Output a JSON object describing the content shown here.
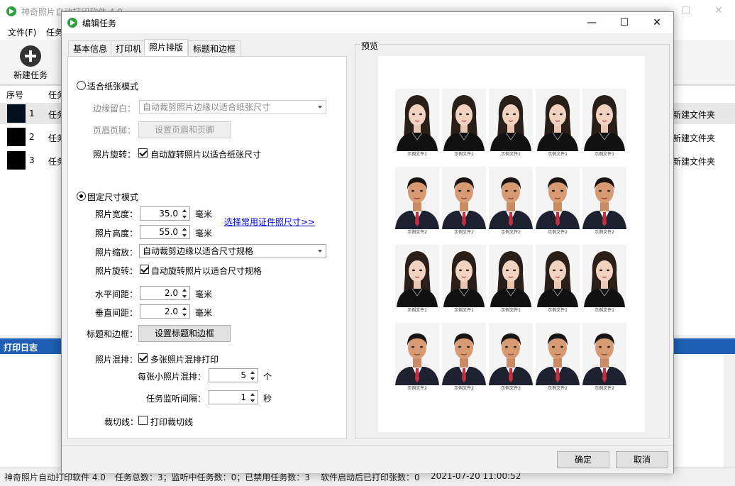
{
  "main": {
    "title": "神奇照片自动打印软件 4.0",
    "menu": [
      "文件(F)",
      "任务"
    ],
    "toolbar": {
      "new_task": "新建任务"
    },
    "list_headers": {
      "index": "序号",
      "task": "任务"
    },
    "tasks": [
      {
        "index": "1",
        "name": "任务",
        "folder": "新建文件夹"
      },
      {
        "index": "2",
        "name": "任务",
        "folder": "新建文件夹"
      },
      {
        "index": "3",
        "name": "任务",
        "folder": "新建文件夹"
      }
    ],
    "log_title": "打印日志",
    "status": {
      "app": "神奇照片自动打印软件 4.0",
      "counts": "任务总数：3；监听中任务数：0；已禁用任务数：3",
      "printed": "软件启动后已打印张数：0",
      "time": "2021-07-20 11:00:52"
    }
  },
  "dialog": {
    "title": "编辑任务",
    "tabs": [
      "基本信息",
      "打印机",
      "照片排版",
      "标题和边框"
    ],
    "active_tab": "照片排版",
    "fit_mode": {
      "label": "适合纸张模式",
      "selected": false,
      "margin_label": "边缘留白：",
      "margin_value": "自动裁剪照片边缘以适合纸张尺寸",
      "header_label": "页眉页脚：",
      "header_button": "设置页眉和页脚",
      "rotate_label": "照片旋转：",
      "rotate_text": "自动旋转照片以适合纸张尺寸",
      "rotate_checked": true
    },
    "fixed_mode": {
      "label": "固定尺寸模式",
      "selected": true,
      "width_label": "照片宽度：",
      "width_value": "35.0",
      "height_label": "照片高度：",
      "height_value": "55.0",
      "unit_mm": "毫米",
      "preset_link": "选择常用证件照尺寸>>",
      "scale_label": "照片缩放：",
      "scale_value": "自动裁剪边缘以适合尺寸规格",
      "rotate_label": "照片旋转：",
      "rotate_text": "自动旋转照片以适合尺寸规格",
      "rotate_checked": true,
      "hgap_label": "水平间距：",
      "hgap_value": "2.0",
      "vgap_label": "垂直间距：",
      "vgap_value": "2.0",
      "title_border_label": "标题和边框：",
      "title_border_button": "设置标题和边框",
      "mix_label": "照片混排：",
      "mix_text": "多张照片混排打印",
      "mix_checked": true,
      "per_sheet_label": "每张小照片混排：",
      "per_sheet_value": "5",
      "per_sheet_unit": "个",
      "interval_label": "任务监听间隔：",
      "interval_value": "1",
      "interval_unit": "秒",
      "cut_label": "裁切线：",
      "cut_text": "打印裁切线",
      "cut_checked": false
    },
    "preview": {
      "label": "预览",
      "rows": [
        {
          "type": "woman",
          "caption": "示例文件1"
        },
        {
          "type": "man",
          "caption": "示例文件2"
        },
        {
          "type": "woman",
          "caption": "示例文件1"
        },
        {
          "type": "man",
          "caption": "示例文件2"
        }
      ],
      "columns": 5
    },
    "buttons": {
      "ok": "确定",
      "cancel": "取消"
    }
  }
}
